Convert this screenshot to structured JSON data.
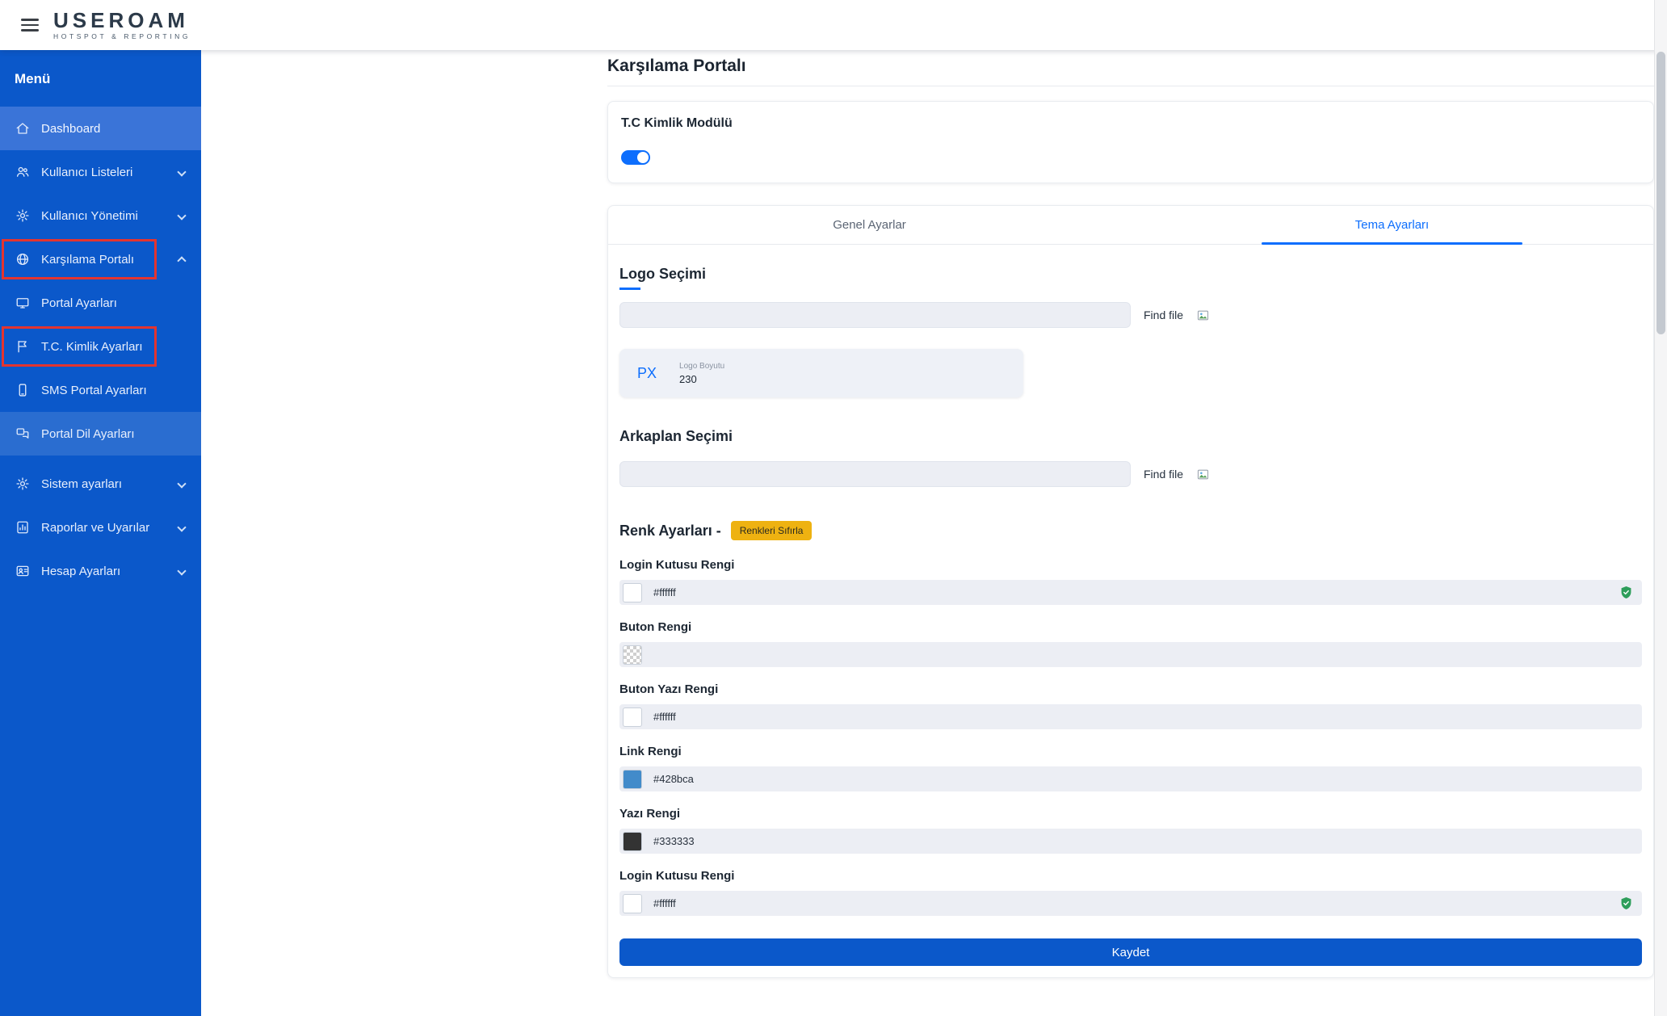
{
  "topbar": {
    "brand": "USEROAM",
    "tagline": "HOTSPOT & REPORTING"
  },
  "sidebar": {
    "menu_label": "Menü",
    "items": [
      {
        "label": "Dashboard",
        "icon": "home",
        "active": true
      },
      {
        "label": "Kullanıcı Listeleri",
        "icon": "users",
        "chevron": "down"
      },
      {
        "label": "Kullanıcı Yönetimi",
        "icon": "gear",
        "chevron": "down"
      },
      {
        "label": "Karşılama Portalı",
        "icon": "globe",
        "chevron": "up"
      },
      {
        "label": "Portal Ayarları",
        "icon": "monitor"
      },
      {
        "label": "T.C. Kimlik Ayarları",
        "icon": "flag"
      },
      {
        "label": "SMS Portal Ayarları",
        "icon": "phone"
      },
      {
        "label": "Portal Dil Ayarları",
        "icon": "language"
      },
      {
        "label": "Sistem ayarları",
        "icon": "gear",
        "chevron": "down"
      },
      {
        "label": "Raporlar ve Uyarılar",
        "icon": "report",
        "chevron": "down"
      },
      {
        "label": "Hesap Ayarları",
        "icon": "account",
        "chevron": "down"
      }
    ]
  },
  "page": {
    "title": "Karşılama Portalı",
    "module_card": {
      "title": "T.C Kimlik Modülü",
      "toggle_state": "on"
    },
    "tabs": [
      {
        "label": "Genel Ayarlar",
        "active": false
      },
      {
        "label": "Tema Ayarları",
        "active": true
      }
    ],
    "logo_section": {
      "heading": "Logo Seçimi",
      "find_file_label": "Find file",
      "size_unit": "PX",
      "size_label": "Logo Boyutu",
      "size_value": "230"
    },
    "background_section": {
      "heading": "Arkaplan Seçimi",
      "find_file_label": "Find file"
    },
    "colors_section": {
      "heading": "Renk Ayarları -",
      "reset_button": "Renkleri Sıfırla",
      "fields": [
        {
          "label": "Login Kutusu Rengi",
          "value": "#ffffff",
          "swatch": "#ffffff",
          "verified": true
        },
        {
          "label": "Buton Rengi",
          "value": "",
          "swatch": "",
          "verified": false
        },
        {
          "label": "Buton Yazı Rengi",
          "value": "#ffffff",
          "swatch": "#ffffff",
          "verified": false
        },
        {
          "label": "Link Rengi",
          "value": "#428bca",
          "swatch": "#428bca",
          "verified": false
        },
        {
          "label": "Yazı Rengi",
          "value": "#333333",
          "swatch": "#333333",
          "verified": false
        },
        {
          "label": "Login Kutusu Rengi",
          "value": "#ffffff",
          "swatch": "#ffffff",
          "verified": true
        }
      ]
    },
    "save_button": "Kaydet"
  },
  "colors": {
    "sidebar_blue": "#0b58ca",
    "active_item_blue": "#3a74d8",
    "accent_blue": "#0d6efd",
    "link_blue": "#428bca",
    "amber": "#eeb211",
    "success_green": "#2e9e5b"
  }
}
